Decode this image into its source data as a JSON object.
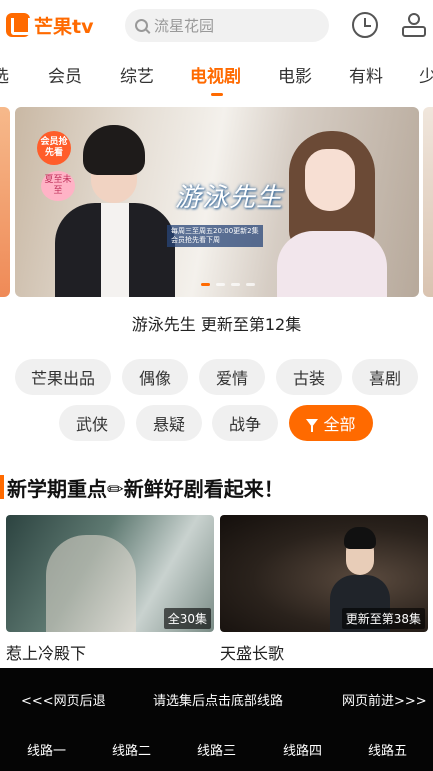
{
  "header": {
    "logo_text": "芒果tv",
    "search_placeholder": "流星花园"
  },
  "nav": {
    "tabs": [
      "选",
      "会员",
      "综艺",
      "电视剧",
      "电影",
      "有料",
      "少"
    ],
    "active_tab": "电视剧"
  },
  "banner": {
    "title": "游泳先生",
    "info_text": "每周三至周五20:00更新2集 会员抢先看下周",
    "badge_top": "会员抢先看",
    "badge_bottom": "夏至未至",
    "caption": "游泳先生 更新至第12集",
    "active_dot": 0,
    "dot_count": 4
  },
  "genres": [
    {
      "label": "芒果出品"
    },
    {
      "label": "偶像"
    },
    {
      "label": "爱情"
    },
    {
      "label": "古装"
    },
    {
      "label": "喜剧"
    },
    {
      "label": "武侠"
    },
    {
      "label": "悬疑"
    },
    {
      "label": "战争"
    },
    {
      "label": "全部",
      "icon": "filter-icon",
      "active": true
    }
  ],
  "section": {
    "title": "新学期重点✏新鲜好剧看起来！"
  },
  "cards": [
    {
      "title": "惹上冷殿下",
      "badge": "全30集"
    },
    {
      "title": "天盛长歌",
      "badge": "更新至第38集"
    }
  ],
  "overlay": {
    "back": "<<<网页后退",
    "hint": "请选集后点击底部线路",
    "forward": "网页前进>>>",
    "routes": [
      "线路一",
      "线路二",
      "线路三",
      "线路四",
      "线路五"
    ]
  },
  "colors": {
    "accent": "#ff6a00",
    "chip_bg": "#f0f0f0",
    "overlay_bg": "#050505"
  }
}
